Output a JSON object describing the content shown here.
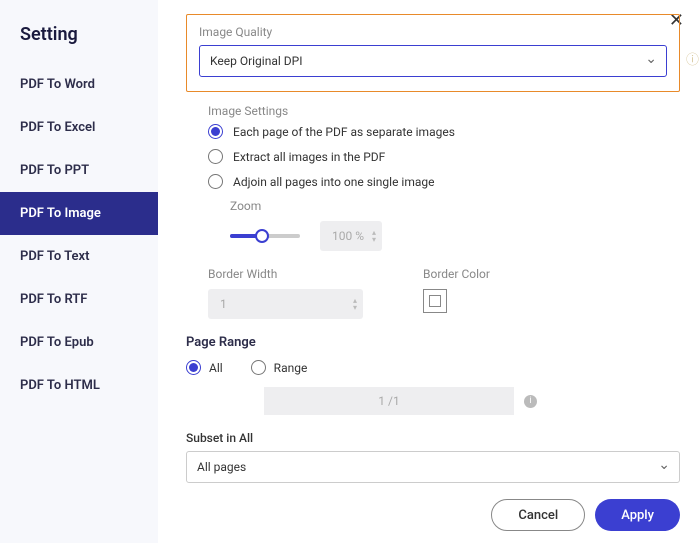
{
  "sidebar": {
    "title": "Setting",
    "items": [
      {
        "label": "PDF To Word"
      },
      {
        "label": "PDF To Excel"
      },
      {
        "label": "PDF To PPT"
      },
      {
        "label": "PDF To Image"
      },
      {
        "label": "PDF To Text"
      },
      {
        "label": "PDF To RTF"
      },
      {
        "label": "PDF To Epub"
      },
      {
        "label": "PDF To HTML"
      }
    ],
    "activeIndex": 3
  },
  "imageQuality": {
    "label": "Image Quality",
    "value": "Keep Original DPI"
  },
  "imageSettings": {
    "label": "Image Settings",
    "options": [
      "Each page of the PDF as separate images",
      "Extract all images in the PDF",
      "Adjoin all pages into one single image"
    ],
    "selectedIndex": 0,
    "zoom": {
      "label": "Zoom",
      "display": "100 %"
    },
    "borderWidth": {
      "label": "Border Width",
      "value": "1"
    },
    "borderColor": {
      "label": "Border Color"
    }
  },
  "pageRange": {
    "title": "Page Range",
    "allLabel": "All",
    "rangeLabel": "Range",
    "selected": "all",
    "rangeValue": "1 /1"
  },
  "subset": {
    "label": "Subset in All",
    "value": "All pages"
  },
  "footer": {
    "cancel": "Cancel",
    "apply": "Apply"
  }
}
